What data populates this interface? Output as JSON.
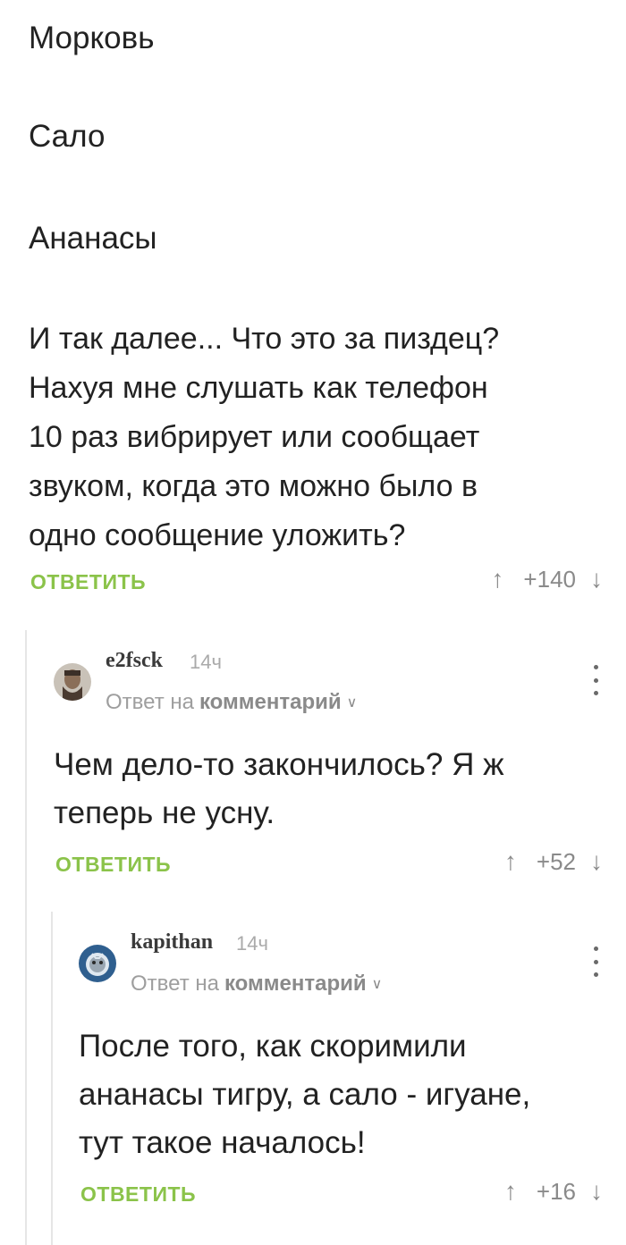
{
  "post": {
    "lines": [
      "Морковь",
      "Сало",
      "Ананасы"
    ],
    "body": "И так далее... Что это за пиздец?\nНахуя мне слушать как телефон\n10 раз вибрирует или сообщает\nзвуком, когда это можно было в\nодно сообщение уложить?",
    "reply_label": "ОТВЕТИТЬ",
    "score": "+140"
  },
  "comments": [
    {
      "username": "e2fsck",
      "time": "14ч",
      "reply_to_prefix": "Ответ на",
      "reply_to_target": "комментарий",
      "text": "Чем дело-то закончилось? Я ж\nтеперь не усну.",
      "reply_label": "ОТВЕТИТЬ",
      "score": "+52"
    },
    {
      "username": "kapithan",
      "time": "14ч",
      "reply_to_prefix": "Ответ на",
      "reply_to_target": "комментарий",
      "text": "После того, как скоримили\nананасы тигру, а сало - игуане,\nтут такое началось!",
      "reply_label": "ОТВЕТИТЬ",
      "score": "+16"
    }
  ],
  "icons": {
    "upvote": "arrow-up-icon",
    "downvote": "arrow-down-icon",
    "menu": "more-vertical-icon",
    "chevron": "chevron-down-icon"
  },
  "colors": {
    "accent": "#8bc34a",
    "text": "#222222",
    "muted": "#9e9e9e"
  }
}
